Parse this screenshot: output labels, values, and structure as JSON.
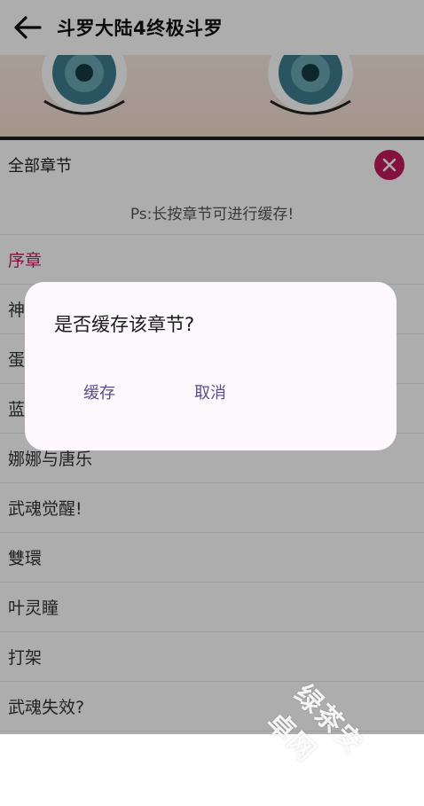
{
  "header": {
    "title": "斗罗大陆4终极斗罗"
  },
  "sheet": {
    "title": "全部章节",
    "hint": "Ps:长按章节可进行缓存!"
  },
  "chapters": [
    {
      "label": "序章",
      "current": true
    },
    {
      "label": "神"
    },
    {
      "label": "蛋"
    },
    {
      "label": "蓝"
    },
    {
      "label": "娜娜与唐乐"
    },
    {
      "label": "武魂觉醒!"
    },
    {
      "label": "雙環"
    },
    {
      "label": "叶灵瞳"
    },
    {
      "label": "打架"
    },
    {
      "label": "武魂失效?"
    }
  ],
  "dialog": {
    "message": "是否缓存该章节?",
    "confirm": "缓存",
    "cancel": "取消"
  },
  "watermark": "绿茶安卓网",
  "colors": {
    "accent": "#c2185b",
    "dialog_button": "#5a4d86",
    "scrim": "rgba(0,0,0,0.32)"
  },
  "icons": {
    "back": "arrow-left-icon",
    "close": "close-icon"
  }
}
